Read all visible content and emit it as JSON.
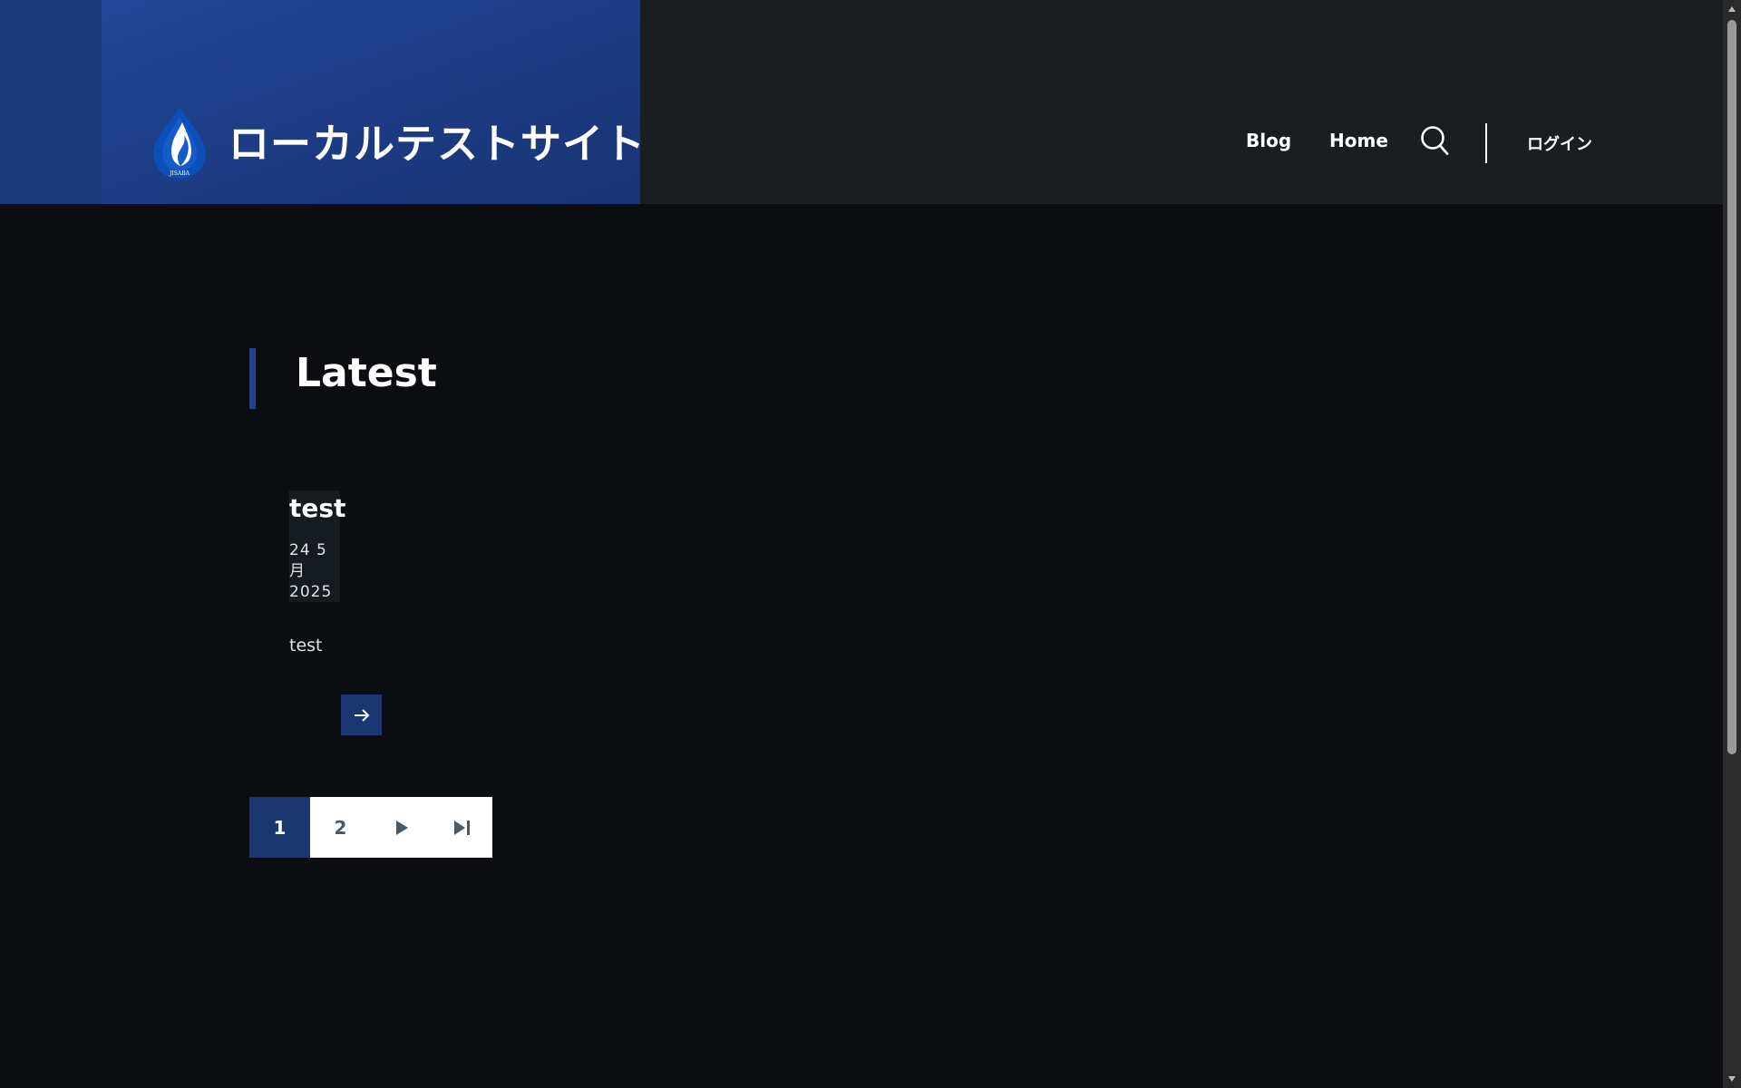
{
  "header": {
    "site_name": "ローカルテストサイト",
    "logo_text": "JISABA",
    "nav": [
      {
        "label": "Blog"
      },
      {
        "label": "Home"
      }
    ],
    "login_label": "ログイン",
    "brand_color": "#1c3b82"
  },
  "main": {
    "section_title": "Latest",
    "posts": [
      {
        "title": "test",
        "date": "24 5 月 2025",
        "excerpt": "test"
      }
    ]
  },
  "pagination": {
    "pages": [
      "1",
      "2"
    ],
    "current": "1",
    "next_icon": "play-icon",
    "last_icon": "skip-to-end-icon"
  },
  "accent_color": "#1b3670"
}
